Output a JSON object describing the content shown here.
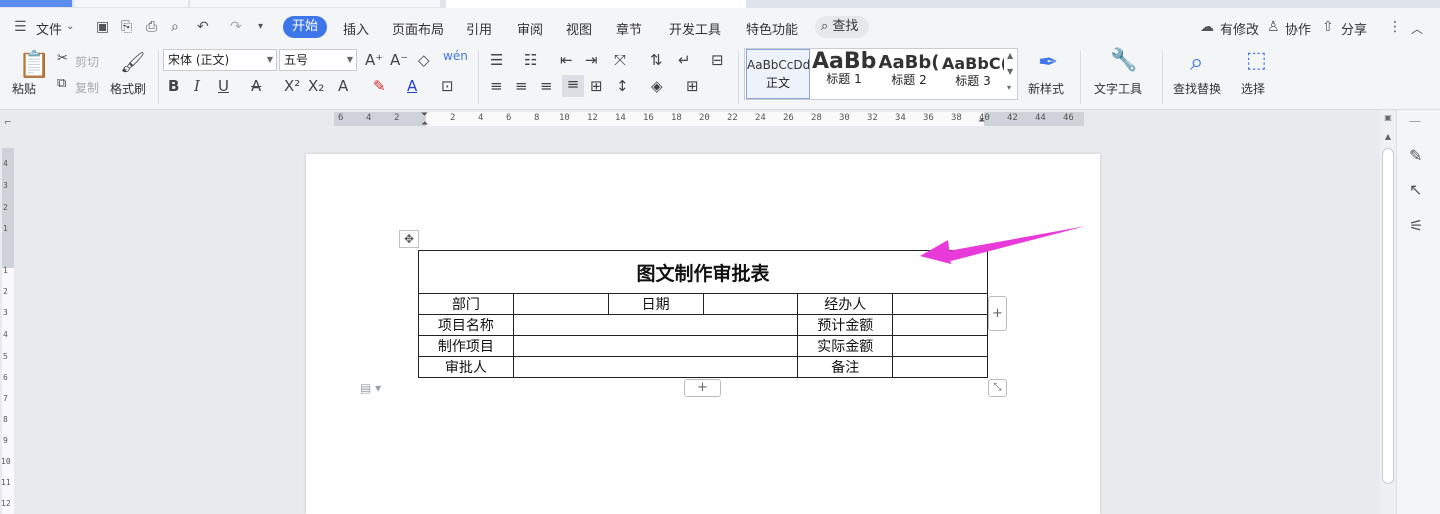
{
  "menubar": {
    "file": "文件",
    "tabs": [
      "开始",
      "插入",
      "页面布局",
      "引用",
      "审阅",
      "视图",
      "章节",
      "开发工具",
      "特色功能"
    ],
    "search": "查找",
    "right": {
      "changes": "有修改",
      "collab": "协作",
      "share": "分享"
    }
  },
  "ribbon": {
    "paste": "粘贴",
    "cut": "剪切",
    "copy": "复制",
    "format_painter": "格式刷",
    "font_name": "宋体 (正文)",
    "font_size": "五号",
    "styles": [
      {
        "sample": "AaBbCcDd",
        "name": "正文"
      },
      {
        "sample": "AaBb",
        "name": "标题 1"
      },
      {
        "sample": "AaBb(",
        "name": "标题 2"
      },
      {
        "sample": "AaBbC(",
        "name": "标题 3"
      }
    ],
    "new_style": "新样式",
    "text_tools": "文字工具",
    "find_replace": "查找替换",
    "select": "选择"
  },
  "ruler_h": [
    "6",
    "4",
    "2",
    "2",
    "4",
    "6",
    "8",
    "10",
    "12",
    "14",
    "16",
    "18",
    "20",
    "22",
    "24",
    "26",
    "28",
    "30",
    "32",
    "34",
    "36",
    "38",
    "40",
    "42",
    "44",
    "46"
  ],
  "ruler_v": [
    "4",
    "3",
    "2",
    "1",
    "1",
    "2",
    "3",
    "4",
    "5",
    "6",
    "7",
    "8",
    "9",
    "10",
    "11",
    "12"
  ],
  "table": {
    "title": "图文制作审批表",
    "row1": [
      "部门",
      "",
      "日期",
      "",
      "经办人",
      ""
    ],
    "row2": [
      "项目名称",
      "",
      "预计金额",
      ""
    ],
    "row3": [
      "制作项目",
      "",
      "实际金额",
      ""
    ],
    "row4": [
      "审批人",
      "",
      "备注",
      ""
    ]
  },
  "colors": {
    "accent": "#3d76e8",
    "arrow": "#e83ad9"
  }
}
